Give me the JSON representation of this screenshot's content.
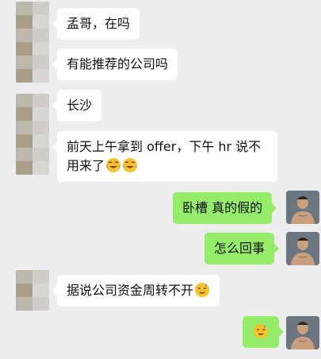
{
  "messages": [
    {
      "side": "in",
      "text": "孟哥，在吗"
    },
    {
      "side": "in",
      "text": "有能推荐的公司吗"
    },
    {
      "side": "in",
      "text": "长沙"
    },
    {
      "side": "in",
      "text_line1": "前天上午拿到 offer，下午 hr 说不",
      "text_line2": "用来了",
      "emoji": [
        "crying-laughing-emoji",
        "crying-laughing-emoji"
      ]
    },
    {
      "side": "out",
      "text": "卧槽 真的假的"
    },
    {
      "side": "out",
      "text": "怎么回事"
    },
    {
      "side": "in",
      "text": "据说公司资金周转不开",
      "emoji": [
        "sweat-smile-emoji"
      ]
    },
    {
      "side": "out",
      "emoji": [
        "sweat-smile-emoji"
      ]
    }
  ],
  "colors": {
    "background": "#ededed",
    "incoming_bubble": "#ffffff",
    "outgoing_bubble": "#95ec69"
  }
}
